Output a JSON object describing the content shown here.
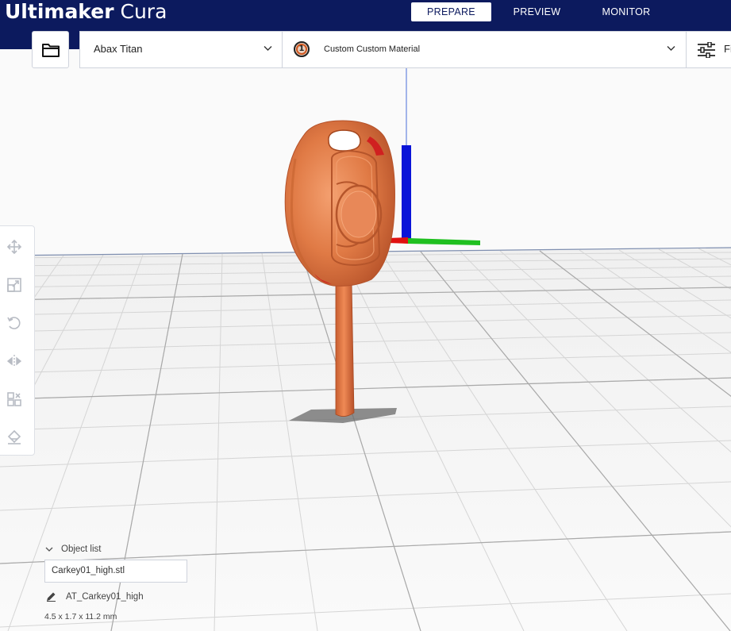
{
  "app": {
    "logo_bold": "Ultimaker",
    "logo_light": " Cura"
  },
  "stages": {
    "prepare": "PREPARE",
    "preview": "PREVIEW",
    "monitor": "MONITOR",
    "active": "PREPARE"
  },
  "toolbar": {
    "open_icon": "folder-icon",
    "printer_name": "Abax Titan",
    "extruder_number": "1",
    "material_name": "Custom Custom Material",
    "settings_label": "Fi",
    "settings_icon": "sliders-icon"
  },
  "tools": {
    "items": [
      "move-icon",
      "scale-icon",
      "rotate-icon",
      "mirror-icon",
      "per-model-settings-icon",
      "support-blocker-icon"
    ]
  },
  "object_list": {
    "header": "Object list",
    "file": "Carkey01_high.stl",
    "job_name": "AT_Carkey01_high",
    "dimensions": "4.5 x 1.7 x 11.2 mm"
  },
  "colors": {
    "header_bg": "#0c1a5e",
    "model": "#e07a45",
    "axis_x": "#e01010",
    "axis_y": "#20c020",
    "axis_z": "#0a14d8"
  }
}
